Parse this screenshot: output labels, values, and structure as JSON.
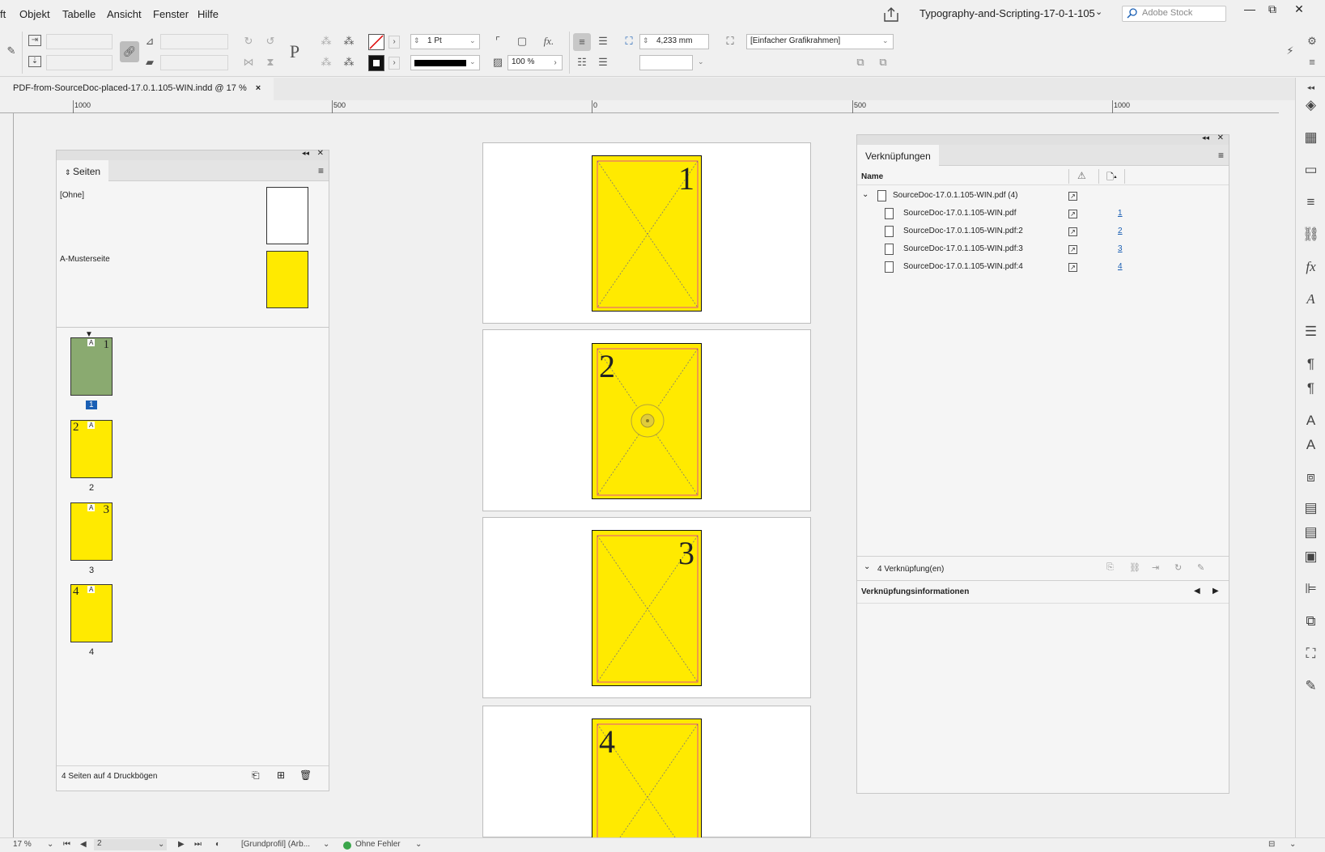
{
  "menu": {
    "items": [
      "ft",
      "Objekt",
      "Tabelle",
      "Ansicht",
      "Fenster",
      "Hilfe"
    ]
  },
  "window": {
    "doc_title": "Typography-and-Scripting-17-0-1-105",
    "stock_search_placeholder": "Adobe Stock",
    "buttons": {
      "minimize": "—",
      "restore": "⧉",
      "close": "✕"
    }
  },
  "control_bar": {
    "stroke_weight": "1 Pt",
    "opacity": "100 %",
    "gutter_value": "4,233 mm",
    "object_style": "[Einfacher Grafikrahmen]",
    "text_frame_icon": "P",
    "fx_icon": "fx."
  },
  "document_tab": {
    "label": "PDF-from-SourceDoc-placed-17.0.1.105-WIN.indd @ 17 %",
    "close": "×"
  },
  "ruler": {
    "labels": [
      "1000",
      "500",
      "0",
      "500",
      "1000"
    ]
  },
  "canvas": {
    "pages": [
      "1",
      "2",
      "3",
      "4"
    ]
  },
  "pages_panel": {
    "title": "Seiten",
    "parents": [
      {
        "label": "[Ohne]"
      },
      {
        "label": "A-Musterseite"
      }
    ],
    "page_prefix": "A",
    "pages": [
      {
        "number": "1",
        "label": "1"
      },
      {
        "number": "2",
        "label": "2"
      },
      {
        "number": "3",
        "label": "3"
      },
      {
        "number": "4",
        "label": "4"
      }
    ],
    "footer": "4 Seiten auf 4 Druckbögen",
    "active_page_color": "#8aaa70",
    "page_color": "#ffea00"
  },
  "links_panel": {
    "title": "Verknüpfungen",
    "column_name": "Name",
    "parent_link": "SourceDoc-17.0.1.105-WIN.pdf (4)",
    "links": [
      {
        "name": "SourceDoc-17.0.1.105-WIN.pdf",
        "page": "1"
      },
      {
        "name": "SourceDoc-17.0.1.105-WIN.pdf:2",
        "page": "2"
      },
      {
        "name": "SourceDoc-17.0.1.105-WIN.pdf:3",
        "page": "3"
      },
      {
        "name": "SourceDoc-17.0.1.105-WIN.pdf:4",
        "page": "4"
      }
    ],
    "count": "4 Verknüpfung(en)",
    "info_title": "Verknüpfungsinformationen"
  },
  "status_bar": {
    "zoom": "17 %",
    "page": "2",
    "profile": "[Grundprofil] (Arb...",
    "preflight": "Ohne Fehler",
    "preflight_color": "#3aa64a"
  }
}
